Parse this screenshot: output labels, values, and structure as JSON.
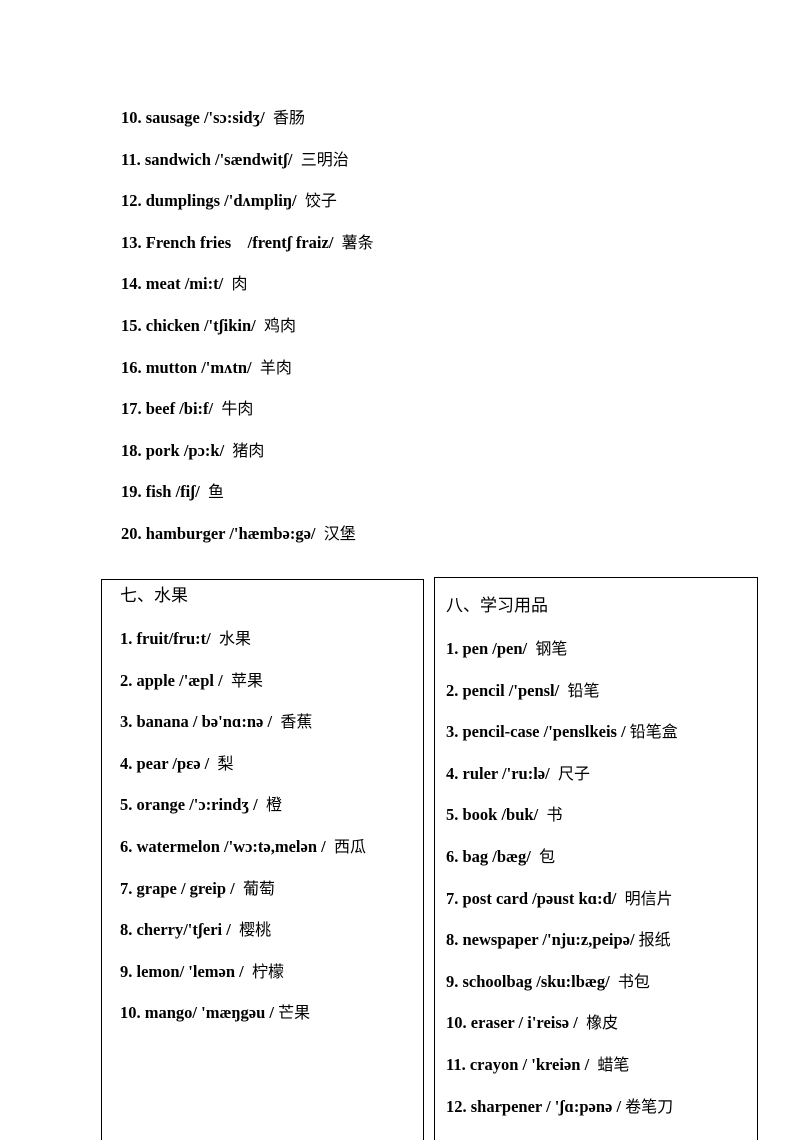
{
  "food_list": {
    "items": [
      {
        "num": "10.",
        "word": "sausage",
        "phonetic": "/'sɔ:sidʒ/",
        "meaning": "香肠"
      },
      {
        "num": "11.",
        "word": "sandwich",
        "phonetic": "/'sændwitʃ/",
        "meaning": "三明治"
      },
      {
        "num": "12.",
        "word": "dumplings",
        "phonetic": "/'dʌmpliŋ/",
        "meaning": "饺子"
      },
      {
        "num": "13.",
        "word": "French fries",
        "phonetic": "   /frentʃ fraiz/",
        "meaning": "薯条"
      },
      {
        "num": "14.",
        "word": "meat",
        "phonetic": "/mi:t/",
        "meaning": "肉"
      },
      {
        "num": "15.",
        "word": "chicken",
        "phonetic": "/'tʃikin/",
        "meaning": "鸡肉"
      },
      {
        "num": "16.",
        "word": "mutton",
        "phonetic": "/'mʌtn/",
        "meaning": "羊肉"
      },
      {
        "num": "17.",
        "word": "beef",
        "phonetic": "/bi:f/",
        "meaning": "牛肉"
      },
      {
        "num": "18.",
        "word": "pork",
        "phonetic": "/pɔ:k/",
        "meaning": "猪肉"
      },
      {
        "num": "19.",
        "word": "fish",
        "phonetic": "/fiʃ/",
        "meaning": "鱼"
      },
      {
        "num": "20.",
        "word": "hamburger",
        "phonetic": "/'hæmbə:gə/",
        "meaning": "汉堡"
      }
    ]
  },
  "fruits": {
    "heading": "七、水果",
    "items": [
      {
        "text": "1. fruit/fru:t/ ",
        "meaning": "水果"
      },
      {
        "text": "2. apple /'æpl / ",
        "meaning": "苹果"
      },
      {
        "text": "3. banana / bə'nɑ:nə / ",
        "meaning": "香蕉"
      },
      {
        "text": "4. pear /pɛə / ",
        "meaning": "梨"
      },
      {
        "text": "5. orange /'ɔ:rindʒ / ",
        "meaning": "橙"
      },
      {
        "text": "6. watermelon /'wɔ:tə,melən / ",
        "meaning": "西瓜"
      },
      {
        "text": "7. grape / greip / ",
        "meaning": "葡萄"
      },
      {
        "text": "8. cherry/'tʃeri / ",
        "meaning": "樱桃"
      },
      {
        "text": "9. lemon/ 'lemən / ",
        "meaning": "柠檬"
      },
      {
        "text": "10. mango/ 'mæŋgəu /",
        "meaning": "芒果"
      }
    ]
  },
  "school_supplies": {
    "heading": "八、学习用品",
    "items": [
      {
        "text": "1. pen /pen/ ",
        "meaning": "钢笔"
      },
      {
        "text": "2. pencil /'pensl/ ",
        "meaning": "铅笔"
      },
      {
        "text": "3. pencil-case /'penslkeis /",
        "meaning": "铅笔盒"
      },
      {
        "text": "4. ruler /'ru:lə/ ",
        "meaning": "尺子"
      },
      {
        "text": "5. book /buk/ ",
        "meaning": "书"
      },
      {
        "text": "6. bag /bæg/ ",
        "meaning": "包"
      },
      {
        "text": "7. post card /pəust kɑ:d/ ",
        "meaning": "明信片"
      },
      {
        "text": "8. newspaper /'nju:z,peipə/",
        "meaning": "报纸"
      },
      {
        "text": "9. schoolbag /sku:lbæg/ ",
        "meaning": "书包"
      },
      {
        "text": "10. eraser / i'reisə / ",
        "meaning": "橡皮"
      },
      {
        "text": "11. crayon / 'kreiən / ",
        "meaning": "蜡笔"
      },
      {
        "text": "12. sharpener / 'ʃɑ:pənə /",
        "meaning": "卷笔刀"
      }
    ]
  }
}
